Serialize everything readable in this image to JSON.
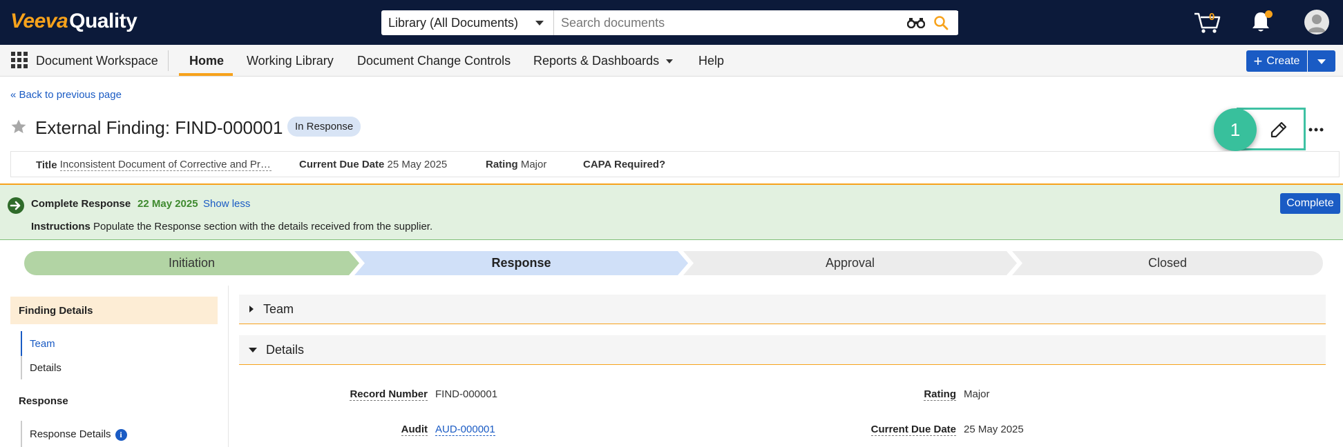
{
  "brand": {
    "part1": "Veeva",
    "part2": "Quality"
  },
  "search": {
    "scope": "Library (All Documents)",
    "placeholder": "Search documents"
  },
  "header_icons": {
    "cart_count": "0",
    "cart": "cart-icon",
    "bell": "bell-icon",
    "avatar": "user-avatar-icon"
  },
  "nav": {
    "workspace": "Document Workspace",
    "items": [
      {
        "label": "Home",
        "active": true
      },
      {
        "label": "Working Library"
      },
      {
        "label": "Document Change Controls"
      },
      {
        "label": "Reports & Dashboards"
      },
      {
        "label": "Help"
      }
    ],
    "create_label": "Create"
  },
  "back_link": "« Back to previous page",
  "record": {
    "title": "External Finding: FIND-000001",
    "status": "In Response",
    "step_marker": "1"
  },
  "key_fields": [
    {
      "label": "Title",
      "value": "Inconsistent Document of Corrective and Preventive Action"
    },
    {
      "label": "Current Due Date",
      "value": "25 May 2025"
    },
    {
      "label": "Rating",
      "value": "Major"
    },
    {
      "label": "CAPA Required?",
      "value": ""
    }
  ],
  "banner": {
    "task": "Complete Response",
    "due": "22 May 2025",
    "toggle": "Show less",
    "instructions_label": "Instructions",
    "instructions": "Populate the Response section with the details received from the supplier.",
    "button": "Complete"
  },
  "stages": [
    {
      "label": "Initiation",
      "state": "done"
    },
    {
      "label": "Response",
      "state": "current"
    },
    {
      "label": "Approval",
      "state": "future"
    },
    {
      "label": "Closed",
      "state": "future"
    }
  ],
  "sidebar": {
    "section1": "Finding Details",
    "section1_items": [
      "Team",
      "Details"
    ],
    "section2": "Response",
    "section2_items": [
      "Response Details"
    ]
  },
  "sections": {
    "team": "Team",
    "details": "Details"
  },
  "details": {
    "record_number_label": "Record Number",
    "record_number": "FIND-000001",
    "rating_label": "Rating",
    "rating": "Major",
    "audit_label": "Audit",
    "audit": "AUD-000001",
    "due_label": "Current Due Date",
    "due": "25 May 2025"
  },
  "colors": {
    "topbar": "#0c1a3a",
    "brand_orange": "#f7a21b",
    "primary_blue": "#1a5bc4",
    "banner_green": "#e2f1e0",
    "edit_highlight": "#3ec1a3"
  }
}
